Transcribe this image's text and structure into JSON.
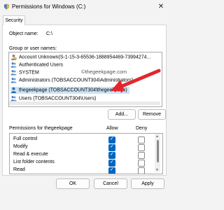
{
  "window": {
    "title": "Permissions for Windows (C:)",
    "close_glyph": "✕"
  },
  "tabs": [
    {
      "label": "Security"
    }
  ],
  "object": {
    "label": "Object name:",
    "value": "C:\\"
  },
  "groups": {
    "label": "Group or user names:",
    "items": [
      {
        "label": "Account Unknown(S-1-15-3-65536-1888954469-73994274...",
        "icon": "unknown-user-icon"
      },
      {
        "label": "Authenticated Users",
        "icon": "users-icon"
      },
      {
        "label": "SYSTEM",
        "icon": "users-icon"
      },
      {
        "label": "Administrators (TOBSACCOUNT304\\Administrators)",
        "icon": "users-icon"
      },
      {
        "label": "thegeekpage (TOBSACCOUNT304\\thegeekpage)",
        "icon": "user-icon",
        "selected": true
      },
      {
        "label": "Users (TOBSACCOUNT304\\Users)",
        "icon": "users-icon"
      }
    ]
  },
  "watermark": "©thegeekpage.com",
  "buttons": {
    "add": "Add...",
    "remove": "Remove",
    "ok": "OK",
    "cancel": "Cancel",
    "apply": "Apply"
  },
  "permissions": {
    "label": "Permissions for thegeekpage",
    "allow_label": "Allow",
    "deny_label": "Deny",
    "rows": [
      {
        "name": "Full control",
        "allow": true,
        "deny": false
      },
      {
        "name": "Modify",
        "allow": true,
        "deny": false
      },
      {
        "name": "Read & execute",
        "allow": true,
        "deny": false
      },
      {
        "name": "List folder contents",
        "allow": true,
        "deny": false
      },
      {
        "name": "Read",
        "allow": true,
        "deny": false
      }
    ]
  },
  "colors": {
    "accent": "#0067c0",
    "annotation": "#e3262d",
    "selection": "#cce4f7"
  }
}
